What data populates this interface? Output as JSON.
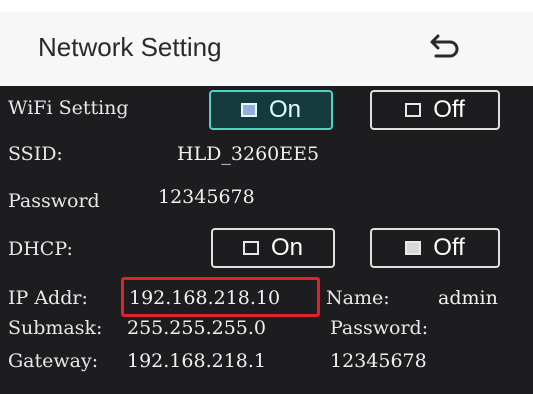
{
  "header": {
    "title": "Network Setting"
  },
  "wifi": {
    "label": "WiFi Setting",
    "on_label": "On",
    "off_label": "Off",
    "selected": "On"
  },
  "ssid": {
    "label": "SSID:",
    "value": "HLD_3260EE5"
  },
  "wifi_password": {
    "label": "Password",
    "value": "12345678"
  },
  "dhcp": {
    "label": "DHCP:",
    "on_label": "On",
    "off_label": "Off",
    "selected": "Off"
  },
  "ip_addr": {
    "label": "IP Addr:",
    "value": "192.168.218.10"
  },
  "name": {
    "label": "Name:",
    "value": "admin"
  },
  "submask": {
    "label": "Submask:",
    "value": "255.255.255.0"
  },
  "login_password": {
    "label": "Password:",
    "value": "12345678"
  },
  "gateway": {
    "label": "Gateway:",
    "value": "192.168.218.1"
  },
  "colors": {
    "panel_bg": "#1d1c1e",
    "header_bg": "#f7f7f7",
    "active_accent": "#4fd1c5",
    "highlight": "#e0222a"
  },
  "icons": {
    "back": "return-arrow-icon",
    "toggle": "square-indicator-icon"
  }
}
